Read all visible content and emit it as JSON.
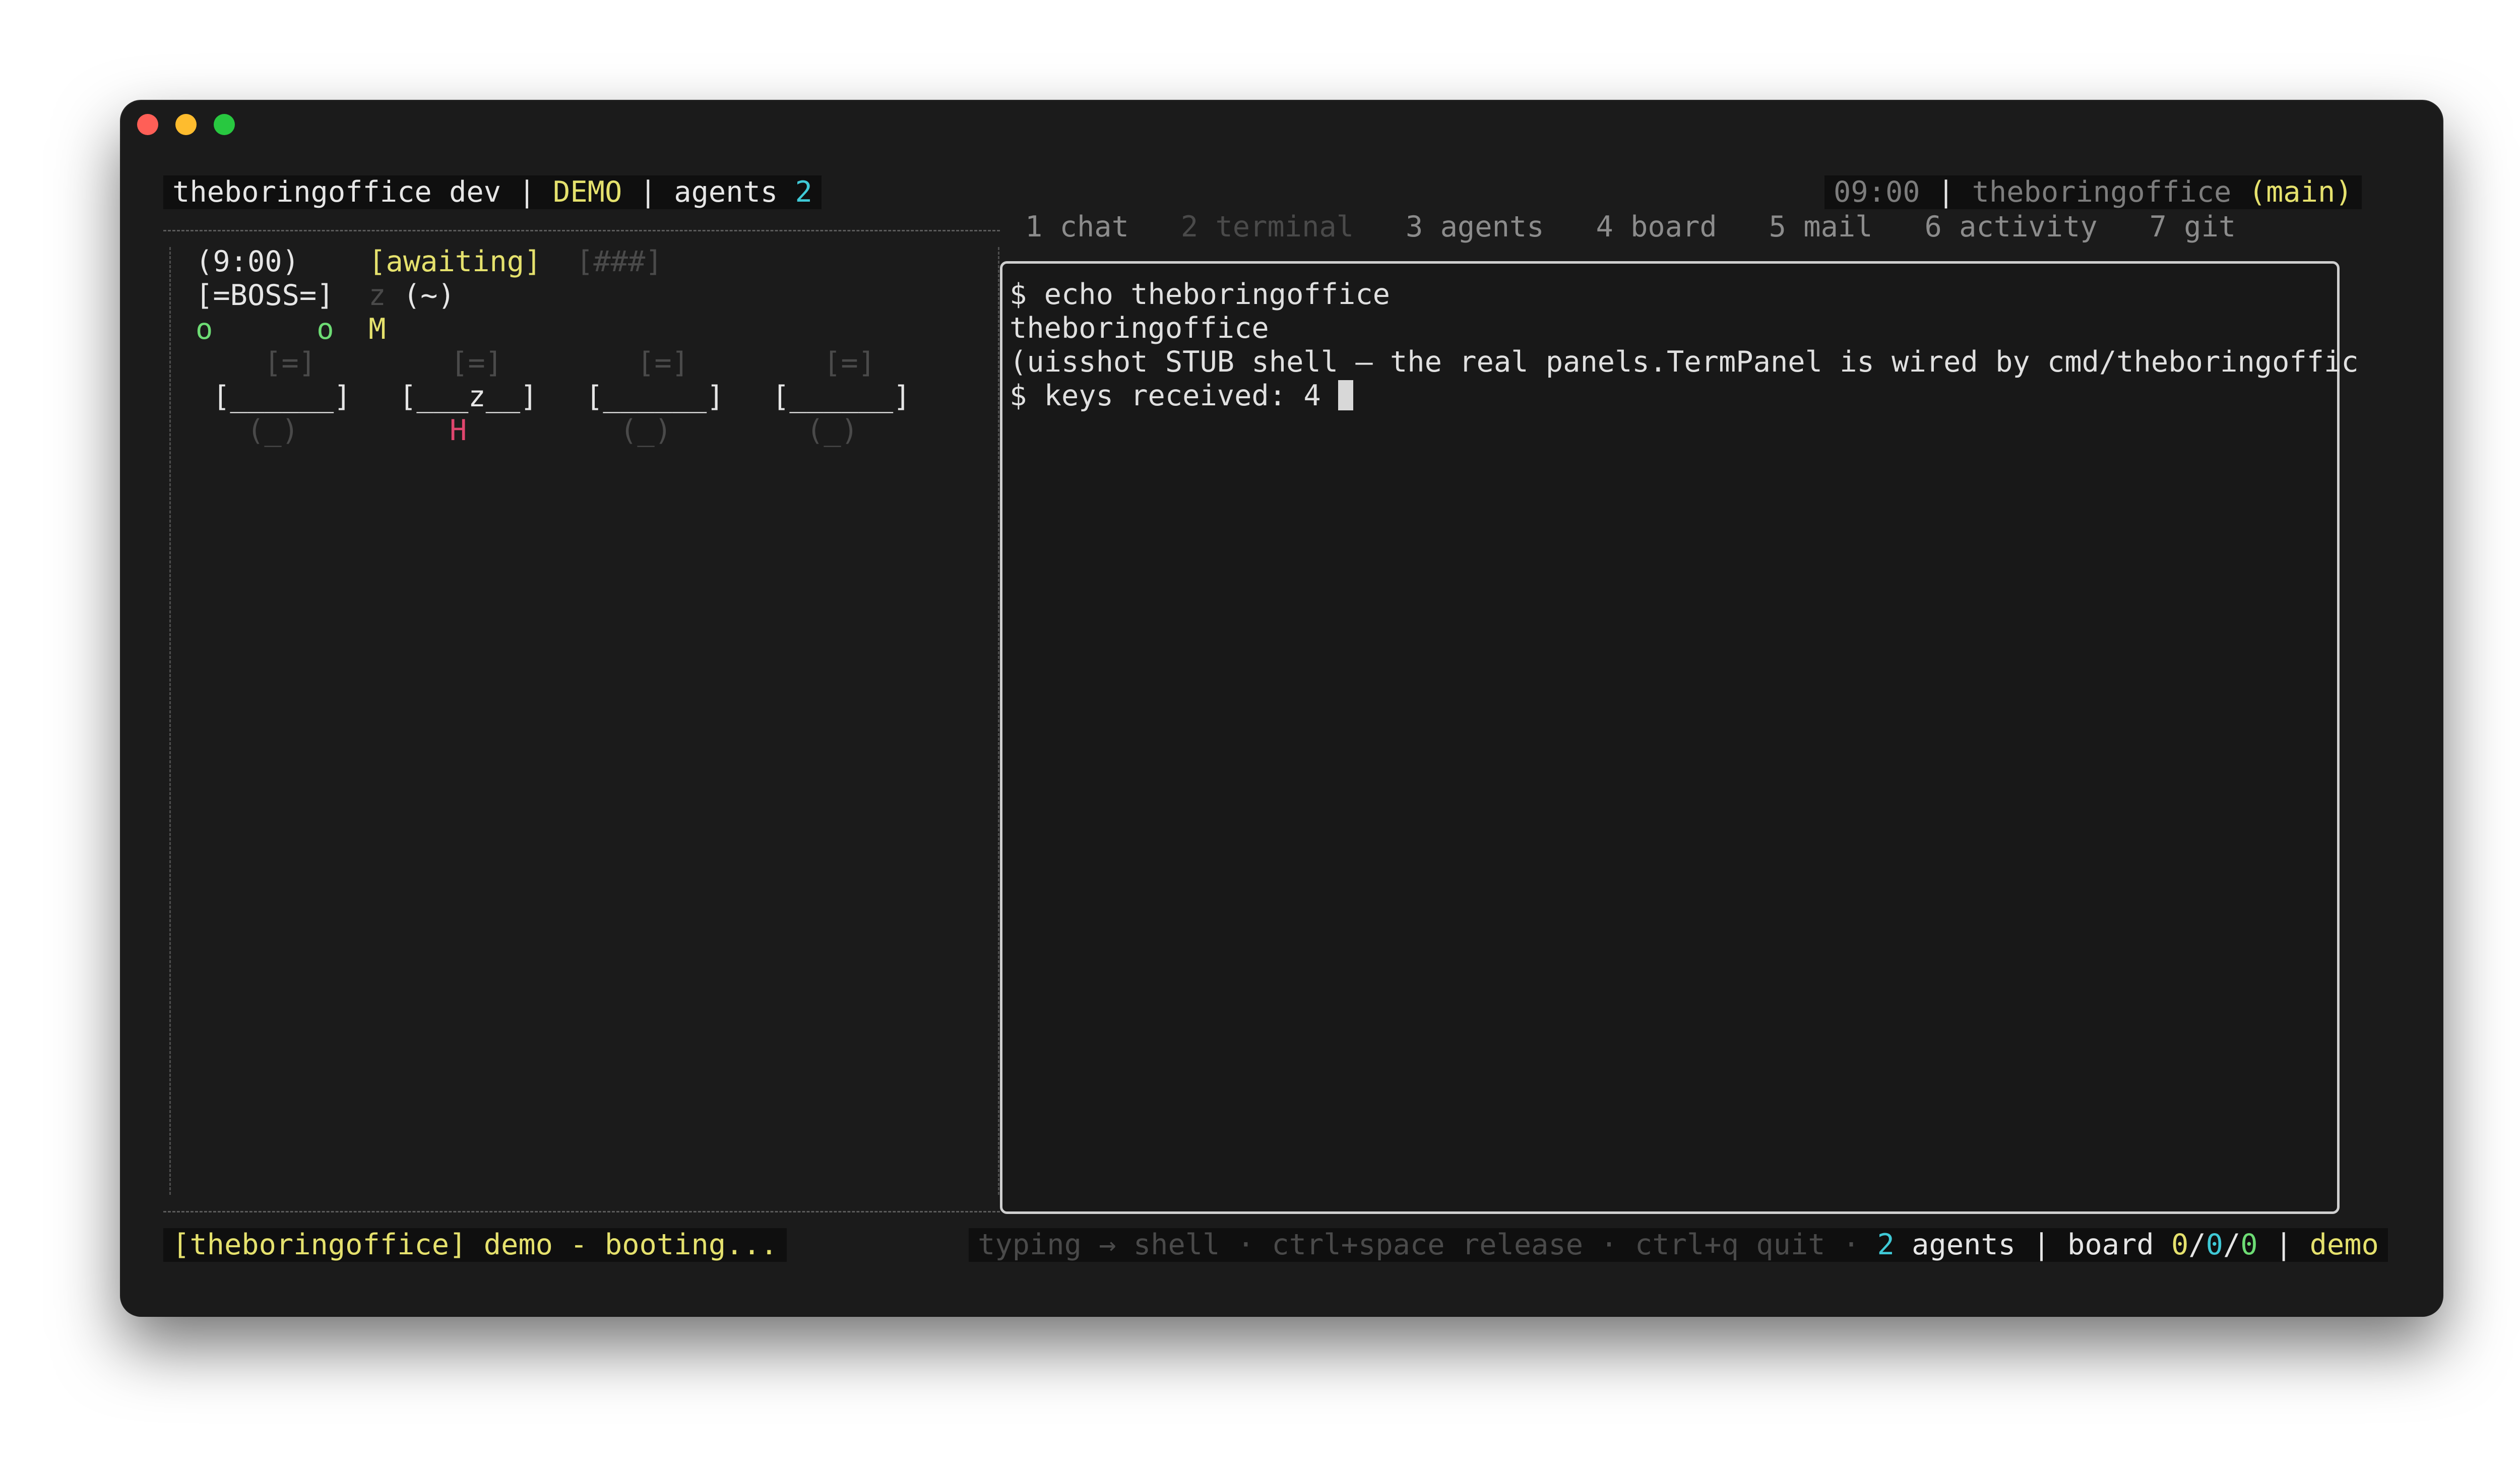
{
  "window": {
    "controls": [
      "close",
      "minimize",
      "zoom"
    ]
  },
  "topbar": {
    "left": {
      "app": "theboringoffice dev",
      "sep1": "|",
      "mode": "DEMO",
      "sep2": "|",
      "agents_label": "agents",
      "agents_count": "2"
    },
    "right": {
      "time": "09:00",
      "sep": "|",
      "repo": "theboringoffice",
      "branch": "(main)"
    }
  },
  "tabs": [
    {
      "label": "1 chat",
      "active": false
    },
    {
      "label": "2 terminal",
      "active": true
    },
    {
      "label": "3 agents",
      "active": false
    },
    {
      "label": "4 board",
      "active": false
    },
    {
      "label": "5 mail",
      "active": false
    },
    {
      "label": "6 activity",
      "active": false
    },
    {
      "label": "7 git",
      "active": false
    }
  ],
  "office": {
    "row1": {
      "time": "(9:00)",
      "status": "[awaiting]",
      "progress": "[###]"
    },
    "row2": {
      "boss": "[=BOSS=]",
      "z": "z",
      "tilde": "(~)"
    },
    "row3": {
      "o1": "o",
      "o2": "o",
      "m": "M"
    },
    "monitors": [
      "[=]",
      "[=]",
      "[=]",
      "[=]"
    ],
    "desks": [
      "[______]",
      "[___z__]",
      "[______]",
      "[______]"
    ],
    "chairs": [
      "(_)",
      "H",
      "(_)",
      "(_)"
    ]
  },
  "terminal": {
    "lines": [
      "$ echo theboringoffice",
      "theboringoffice",
      "(uisshot STUB shell — the real panels.TermPanel is wired by cmd/theboringoffic",
      "$ keys received: 4 "
    ]
  },
  "statusbar": {
    "left": "[theboringoffice] demo - booting...",
    "hints": "typing → shell · ctrl+space release · ctrl+q quit ·",
    "agents_count": "2",
    "agents_label": "agents",
    "sep1": "|",
    "board_label": "board",
    "board_a": "0",
    "board_b": "0",
    "board_c": "0",
    "slash": "/",
    "sep2": "|",
    "mode": "demo"
  },
  "colors": {
    "yellow": "#e5e16d",
    "cyan": "#3fc9d6",
    "green": "#6ddc74",
    "red": "#e0466e",
    "background": "#1b1b1b"
  }
}
